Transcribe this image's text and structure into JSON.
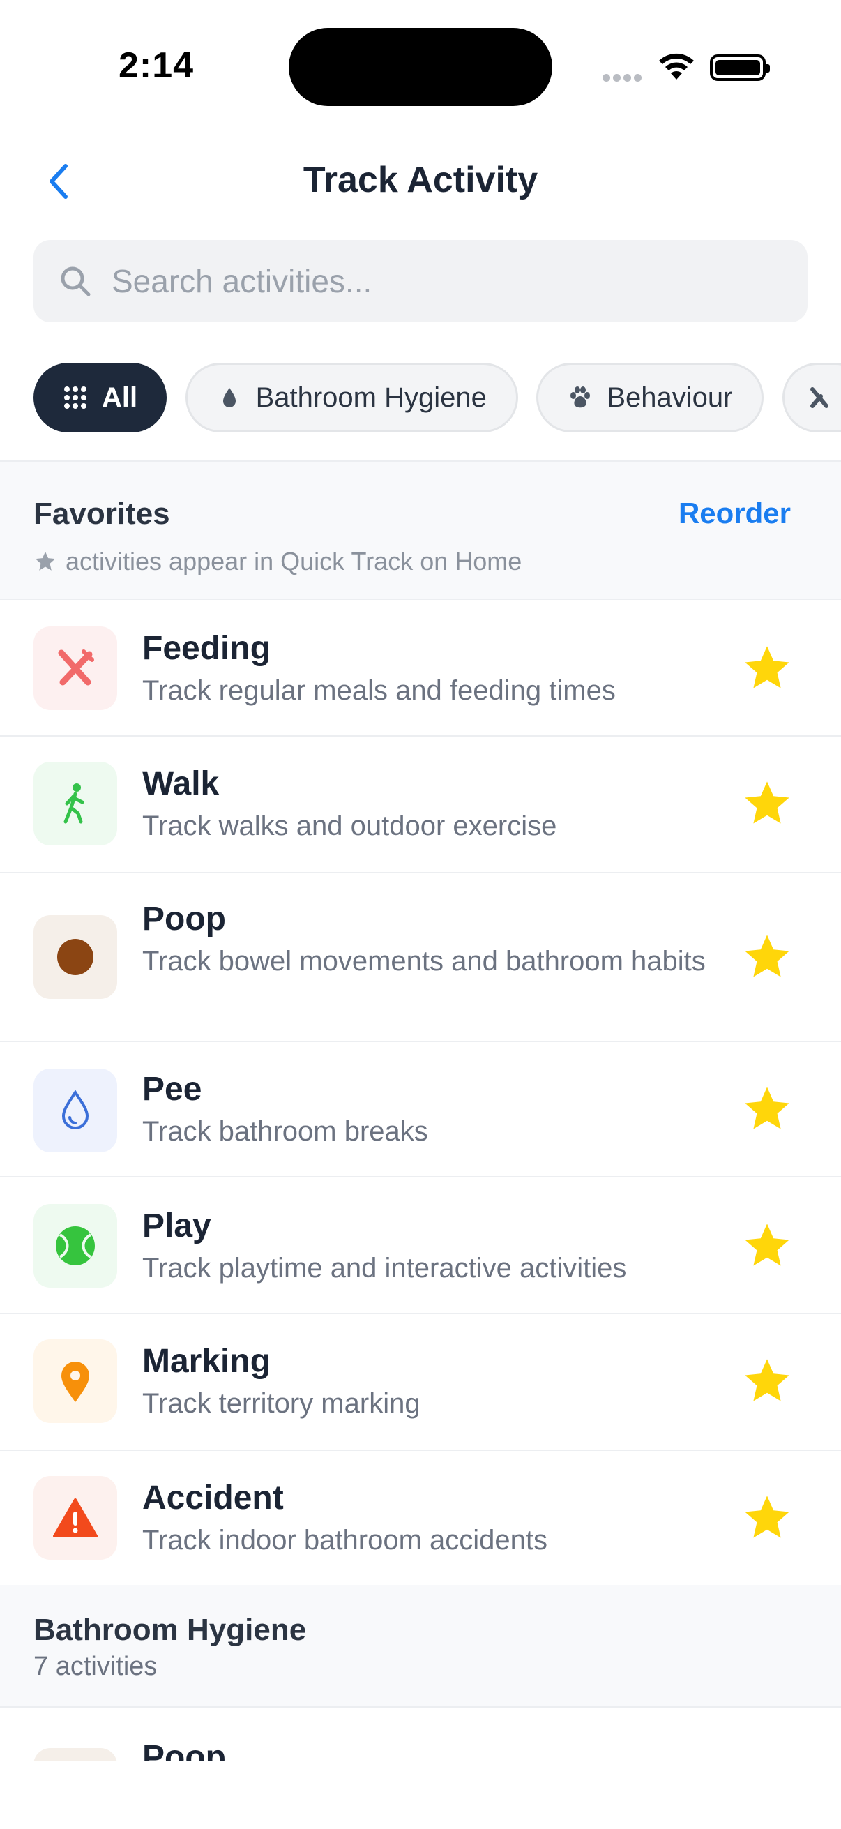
{
  "status_bar": {
    "time": "2:14"
  },
  "nav": {
    "title": "Track Activity"
  },
  "search": {
    "placeholder": "Search activities..."
  },
  "chips": [
    {
      "label": "All",
      "icon": "grid-icon",
      "active": true
    },
    {
      "label": "Bathroom Hygiene",
      "icon": "droplet-icon",
      "active": false
    },
    {
      "label": "Behaviour",
      "icon": "paw-icon",
      "active": false
    }
  ],
  "favorites": {
    "title": "Favorites",
    "reorder_label": "Reorder",
    "subtitle": "activities appear in Quick Track on Home"
  },
  "activities": [
    {
      "name": "Feeding",
      "description": "Track regular meals and feeding times",
      "icon": "utensils-icon",
      "icon_color": "#f16a6a",
      "icon_bg": "#fdf0f0"
    },
    {
      "name": "Walk",
      "description": "Track walks and outdoor exercise",
      "icon": "walking-person-icon",
      "icon_color": "#34c24a",
      "icon_bg": "#eefaf0"
    },
    {
      "name": "Poop",
      "description": "Track bowel movements and bathroom habits",
      "icon": "brown-circle-icon",
      "icon_color": "#8b4513",
      "icon_bg": "#f5efe9"
    },
    {
      "name": "Pee",
      "description": "Track bathroom breaks",
      "icon": "droplet-outline-icon",
      "icon_color": "#3b6fd8",
      "icon_bg": "#eef2fd"
    },
    {
      "name": "Play",
      "description": "Track playtime and interactive activities",
      "icon": "tennis-ball-icon",
      "icon_color": "#36c43e",
      "icon_bg": "#eefaf0"
    },
    {
      "name": "Marking",
      "description": "Track territory marking",
      "icon": "map-pin-icon",
      "icon_color": "#f7900a",
      "icon_bg": "#fff6ea"
    },
    {
      "name": "Accident",
      "description": "Track indoor bathroom accidents",
      "icon": "warning-triangle-icon",
      "icon_color": "#f24a1c",
      "icon_bg": "#fdf1ee"
    }
  ],
  "section": {
    "title": "Bathroom Hygiene",
    "count": "7 activities"
  },
  "partial_item": {
    "name": "Poop"
  },
  "colors": {
    "accent": "#1a7df0",
    "star": "#ffd60a",
    "chip_active": "#1e293b"
  }
}
